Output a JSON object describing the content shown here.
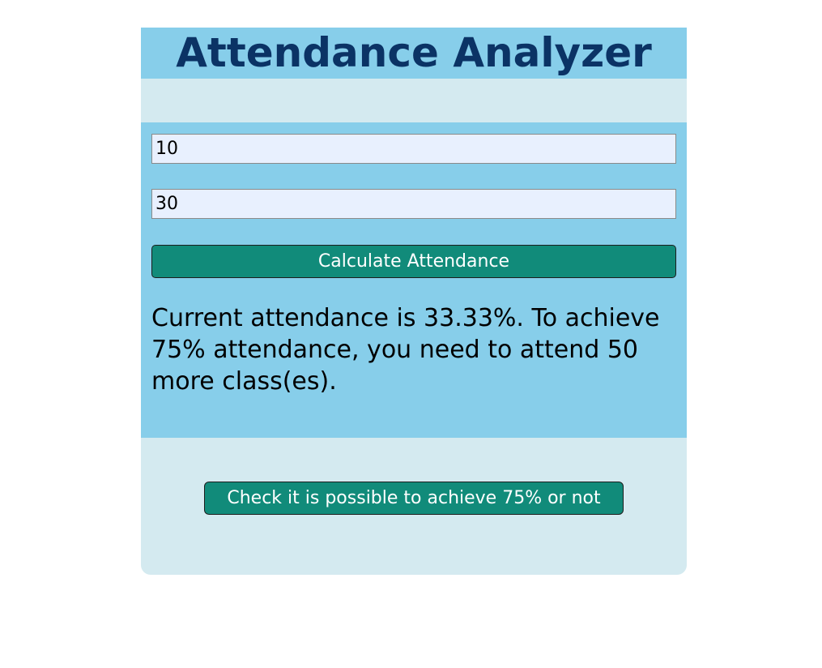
{
  "header": {
    "title": "Attendance Analyzer"
  },
  "form": {
    "present_value": "10",
    "total_value": "30",
    "calculate_label": "Calculate Attendance"
  },
  "result": {
    "text": "Current attendance is 33.33%. To achieve 75% attendance, you need to attend 50 more class(es)."
  },
  "check": {
    "label": "Check it is possible to achieve 75% or not"
  },
  "colors": {
    "title_bar": "#87ceea",
    "title_text": "#0b3365",
    "card_background": "#d4eaf0",
    "button": "#118b7a",
    "input_background": "#e8f0fe"
  }
}
